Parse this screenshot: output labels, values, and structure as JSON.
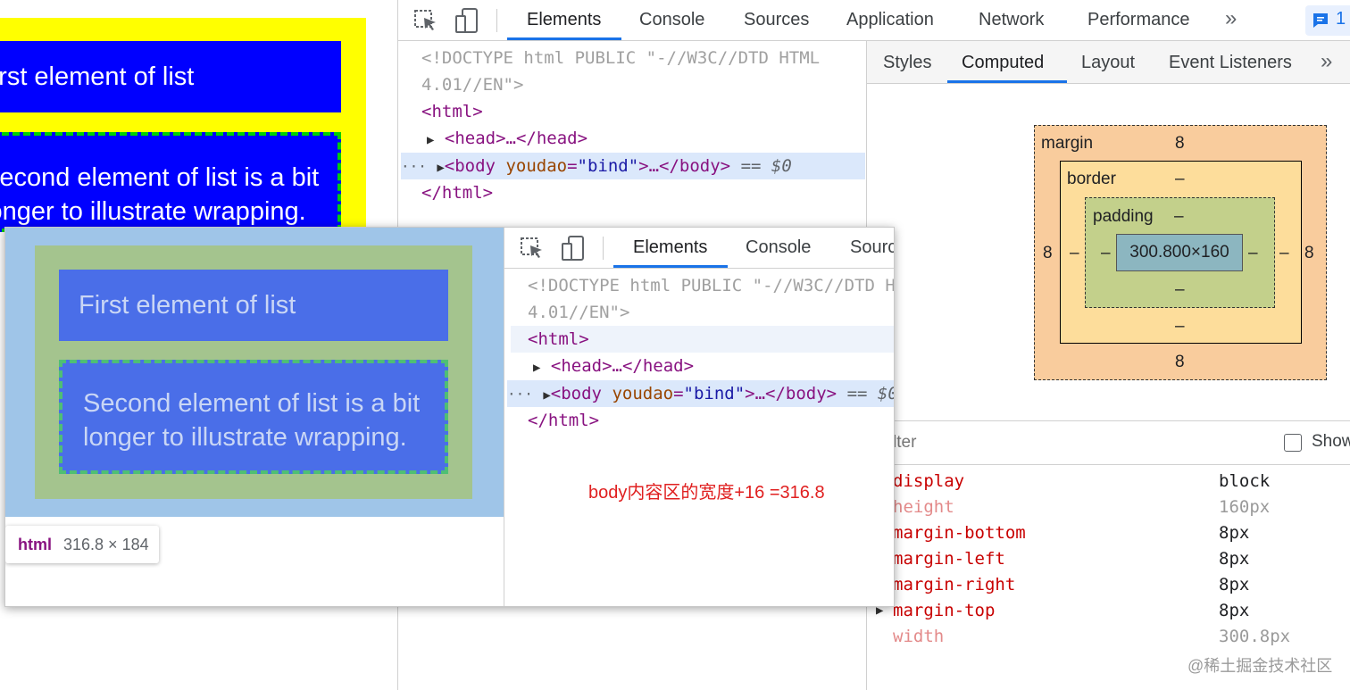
{
  "page_preview": {
    "item1_text": "First element of list",
    "item2_line1": "Second element of list is a bit",
    "item2_line2": "longer to illustrate wrapping."
  },
  "devtools": {
    "tabs": [
      "Elements",
      "Console",
      "Sources",
      "Application",
      "Network",
      "Performance"
    ],
    "active_tab": "Elements",
    "more_tabs_icon": "chevrons-right-icon",
    "issues_badge_count": "1",
    "dom_tree": {
      "doctype_line1": "<!DOCTYPE html PUBLIC \"-//W3C//DTD HTML",
      "doctype_line2": "4.01//EN\">",
      "html_open": "<html>",
      "head_collapsed": "<head>…</head>",
      "body_open_tag": "<body ",
      "body_attr_name": "youdao",
      "body_attr_eq": "=",
      "body_attr_value": "\"bind\"",
      "body_close_part": ">…</body>",
      "selected_marker": "== $0",
      "html_close": "</html>",
      "dots": "···"
    },
    "sidebar_tabs": [
      "Styles",
      "Computed",
      "Layout",
      "Event Listeners"
    ],
    "active_sidebar_tab": "Computed",
    "box_model": {
      "margin_label": "margin",
      "margin_top": "8",
      "margin_right": "8",
      "margin_bottom": "8",
      "margin_left": "8",
      "border_label": "border",
      "border_top": "–",
      "border_right": "–",
      "border_bottom": "–",
      "border_left": "–",
      "padding_label": "padding",
      "padding_top": "–",
      "padding_right": "–",
      "padding_bottom": "–",
      "padding_left": "–",
      "content_size": "300.800×160"
    },
    "filter_placeholder": "lter",
    "show_all_label": "Show",
    "computed_properties": [
      {
        "name": "display",
        "value": "block",
        "inherited": false
      },
      {
        "name": "height",
        "value": "160px",
        "inherited": true
      },
      {
        "name": "margin-bottom",
        "value": "8px",
        "inherited": false
      },
      {
        "name": "margin-left",
        "value": "8px",
        "inherited": false
      },
      {
        "name": "margin-right",
        "value": "8px",
        "inherited": false
      },
      {
        "name": "margin-top",
        "value": "8px",
        "inherited": false
      },
      {
        "name": "width",
        "value": "300.8px",
        "inherited": true
      }
    ]
  },
  "overlay_screenshot": {
    "item1_text": "First element of list",
    "item2_line1": "Second element of list is a bit",
    "item2_line2": "longer to illustrate wrapping.",
    "tooltip_tag": "html",
    "tooltip_size": "316.8 × 184",
    "tabs": [
      "Elements",
      "Console",
      "Sourc"
    ],
    "active_tab": "Elements",
    "annotation": "body内容区的宽度+16 =316.8"
  },
  "watermark": "@稀土掘金技术社区",
  "colors": {
    "yellow": "#ffff00",
    "blue": "#0000ff",
    "green_dash": "#00d000",
    "accent": "#1a73e8",
    "annotation_red": "#e02020"
  }
}
